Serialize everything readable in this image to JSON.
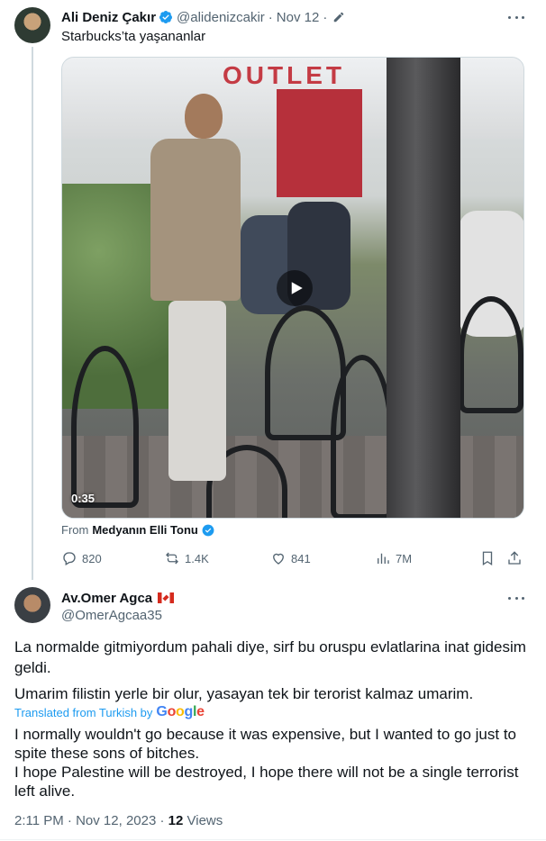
{
  "tweet1": {
    "name": "Ali Deniz Çakır",
    "handle": "@alidenizcakir",
    "date": "Nov 12",
    "separator": "·",
    "text": "Starbucks’ta yaşananlar",
    "media": {
      "store_sign": "OUTLET",
      "duration": "0:35"
    },
    "from_label": "From",
    "from_name": "Medyanın Elli Tonu",
    "actions": {
      "replies": "820",
      "retweets": "1.4K",
      "likes": "841",
      "views": "7M"
    }
  },
  "tweet2": {
    "name": "Av.Omer Agca",
    "handle": "@OmerAgcaa35",
    "text_line1": "La normalde gitmiyordum pahali diye, sirf bu oruspu evlatlarina inat gidesim geldi.",
    "text_line2": "Umarim filistin yerle bir olur, yasayan tek bir terorist kalmaz umarim.",
    "translated_label": "Translated from Turkish by",
    "translator": "Google",
    "translation_line1": "I normally wouldn't go because it was expensive, but I wanted to go just to spite these sons of bitches.",
    "translation_line2": "I hope Palestine will be destroyed, I hope there will not be a single terrorist left alive.",
    "timestamp": "2:11 PM · Nov 12, 2023 ·",
    "views_count": "12",
    "views_label": "Views"
  },
  "colors": {
    "verified_blue": "#1d9bf0",
    "text": "#0f1419",
    "muted": "#536471"
  },
  "icons": [
    "verified-badge-icon",
    "edit-pencil-icon",
    "more-dots-icon",
    "play-icon",
    "reply-icon",
    "retweet-icon",
    "like-icon",
    "views-icon",
    "bookmark-icon",
    "share-icon",
    "canada-flag-icon"
  ]
}
